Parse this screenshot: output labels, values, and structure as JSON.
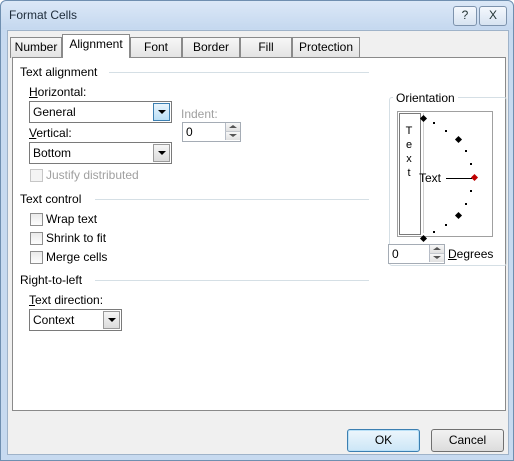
{
  "window": {
    "title": "Format Cells",
    "help_label": "?",
    "close_label": "X"
  },
  "tabs": [
    {
      "label": "Number"
    },
    {
      "label": "Alignment"
    },
    {
      "label": "Font"
    },
    {
      "label": "Border"
    },
    {
      "label": "Fill"
    },
    {
      "label": "Protection"
    }
  ],
  "active_tab": "Alignment",
  "text_alignment": {
    "title": "Text alignment",
    "horizontal_label": "Horizontal:",
    "horizontal_value": "General",
    "vertical_label": "Vertical:",
    "vertical_value": "Bottom",
    "indent_label": "Indent:",
    "indent_value": "0",
    "justify_distributed_label": "Justify distributed"
  },
  "text_control": {
    "title": "Text control",
    "wrap_text_label": "Wrap text",
    "shrink_to_fit_label": "Shrink to fit",
    "merge_cells_label": "Merge cells"
  },
  "right_to_left": {
    "title": "Right-to-left",
    "text_direction_label": "Text direction:",
    "text_direction_value": "Context"
  },
  "orientation": {
    "title": "Orientation",
    "vertical_letters": [
      "T",
      "e",
      "x",
      "t"
    ],
    "dial_text": "Text",
    "degrees_value": "0",
    "degrees_label": "Degrees"
  },
  "buttons": {
    "ok": "OK",
    "cancel": "Cancel"
  },
  "colors": {
    "accent": "#3c7fb1",
    "dial_marker": "#c00000"
  }
}
